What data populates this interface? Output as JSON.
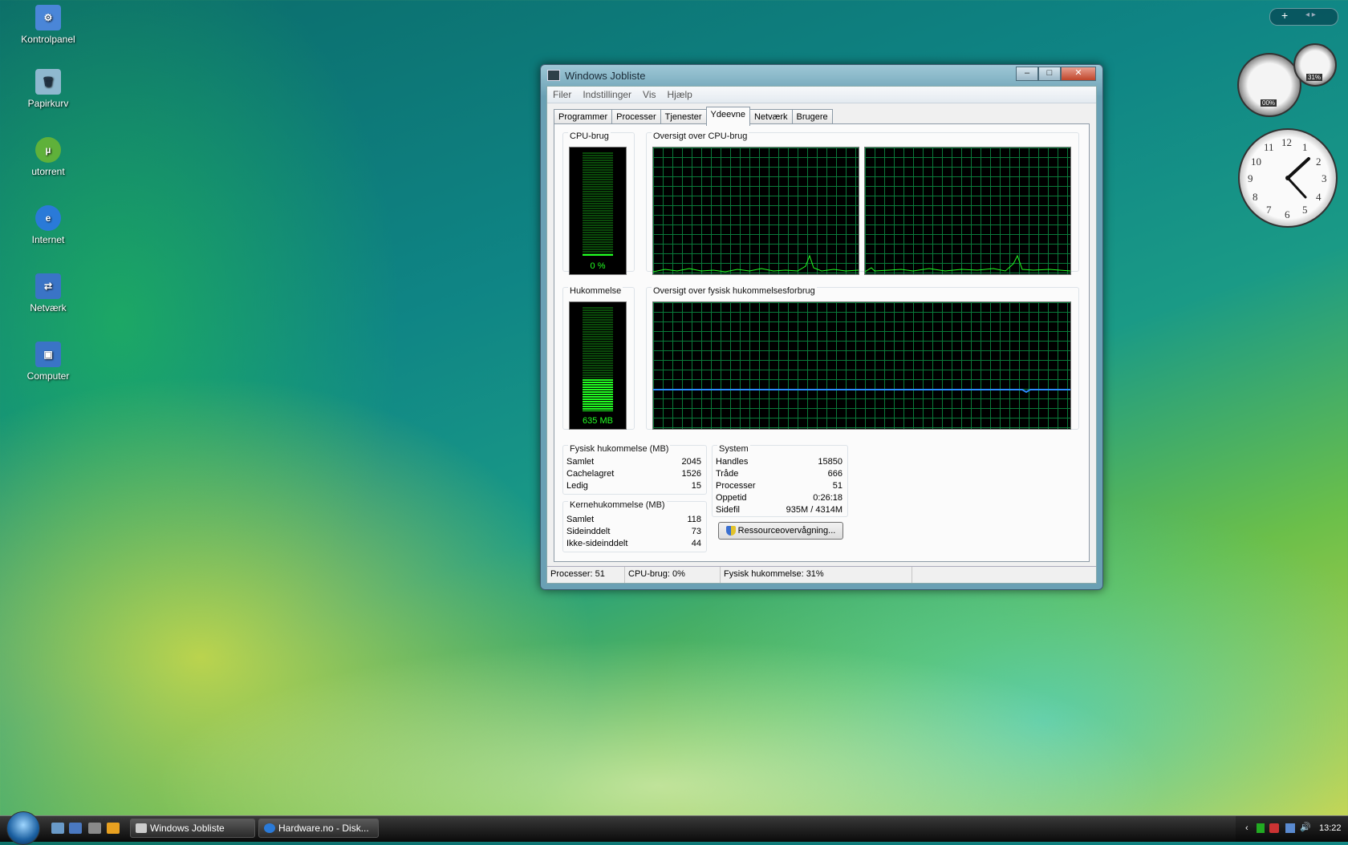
{
  "desktop": {
    "icons": [
      {
        "label": "Kontrolpanel",
        "icon": "control-panel-icon",
        "color": "#4a86d8"
      },
      {
        "label": "Papirkurv",
        "icon": "recycle-bin-icon",
        "color": "#8fb8cf"
      },
      {
        "label": "utorrent",
        "icon": "utorrent-icon",
        "color": "#5fb13a"
      },
      {
        "label": "Internet",
        "icon": "internet-explorer-icon",
        "color": "#2a7ad8"
      },
      {
        "label": "Netværk",
        "icon": "network-icon",
        "color": "#3a74c6"
      },
      {
        "label": "Computer",
        "icon": "computer-icon",
        "color": "#3a74c6"
      }
    ]
  },
  "window": {
    "title": "Windows Jobliste",
    "controls": {
      "minimize": "–",
      "maximize": "□",
      "close": "✕"
    },
    "menu": [
      "Filer",
      "Indstillinger",
      "Vis",
      "Hjælp"
    ],
    "tabs": [
      "Programmer",
      "Processer",
      "Tjenester",
      "Ydeevne",
      "Netværk",
      "Brugere"
    ],
    "active_tab": "Ydeevne",
    "cpu": {
      "title": "CPU-brug",
      "value_label": "0 %",
      "level_percent": 0
    },
    "cpu_history": {
      "title": "Oversigt over CPU-brug"
    },
    "memory": {
      "title": "Hukommelse",
      "value_label": "635 MB",
      "level_percent": 31
    },
    "memory_history": {
      "title": "Oversigt over fysisk hukommelsesforbrug"
    },
    "physical": {
      "title": "Fysisk hukommelse (MB)",
      "rows": [
        [
          "Samlet",
          "2045"
        ],
        [
          "Cachelagret",
          "1526"
        ],
        [
          "Ledig",
          "15"
        ]
      ]
    },
    "kernel": {
      "title": "Kernehukommelse (MB)",
      "rows": [
        [
          "Samlet",
          "118"
        ],
        [
          "Sideinddelt",
          "73"
        ],
        [
          "Ikke-sideinddelt",
          "44"
        ]
      ]
    },
    "system": {
      "title": "System",
      "rows": [
        [
          "Handles",
          "15850"
        ],
        [
          "Tråde",
          "666"
        ],
        [
          "Processer",
          "51"
        ],
        [
          "Oppetid",
          "0:26:18"
        ],
        [
          "Sidefil",
          "935M / 4314M"
        ]
      ]
    },
    "resource_button": "Ressourceovervågning...",
    "status": {
      "processes": "Processer: 51",
      "cpu": "CPU-brug: 0%",
      "memory": "Fysisk hukommelse: 31%"
    }
  },
  "gadgets": {
    "toolbar": {
      "add": "+",
      "nav": "◂ ▸"
    },
    "cpu_gauge_label": "00%",
    "memory_gauge_label": "31%",
    "clock_numbers": [
      "12",
      "1",
      "2",
      "3",
      "4",
      "5",
      "6",
      "7",
      "8",
      "9",
      "10",
      "11"
    ]
  },
  "taskbar": {
    "buttons": [
      {
        "label": "Windows Jobliste",
        "icon": "task-manager-icon"
      },
      {
        "label": "Hardware.no - Disk...",
        "icon": "internet-explorer-icon"
      }
    ],
    "time": "13:22"
  }
}
